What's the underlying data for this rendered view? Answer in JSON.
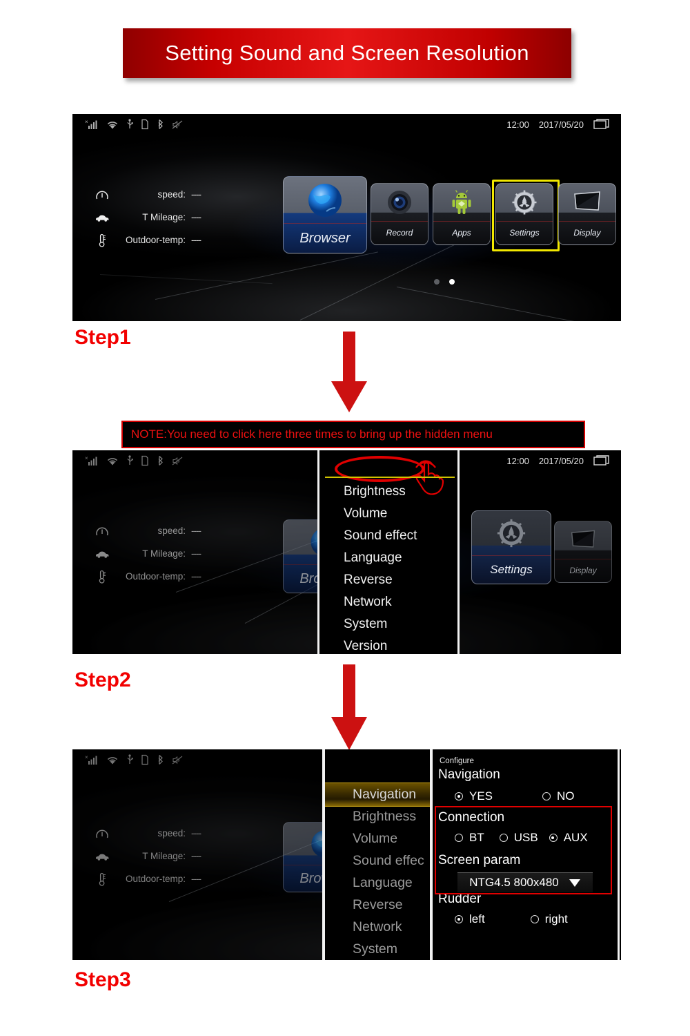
{
  "title": {
    "text": "Setting Sound and Screen Resolution"
  },
  "note": {
    "text": "NOTE:You need to click here three times to bring up the hidden menu"
  },
  "steps": {
    "step1": "Step1",
    "step2": "Step2",
    "step3": "Step3"
  },
  "statusbar": {
    "time": "12:00",
    "date": "2017/05/20",
    "icons": [
      "signal-x-icon",
      "wifi-icon",
      "usb-icon",
      "sdcard-icon",
      "bluetooth-icon",
      "mute-icon"
    ],
    "window_icon": "window-stack-icon"
  },
  "vehicle_info": {
    "rows": [
      {
        "icon": "speedometer-icon",
        "label": "speed:",
        "value": "----"
      },
      {
        "icon": "car-icon",
        "label": "T Mileage:",
        "value": "----"
      },
      {
        "icon": "thermometer-icon",
        "label": "Outdoor-temp:",
        "value": "----"
      }
    ]
  },
  "home_tiles": [
    {
      "label": "Browser",
      "icon": "globe-icon"
    },
    {
      "label": "Record",
      "icon": "camera-lens-icon"
    },
    {
      "label": "Apps",
      "icon": "android-robot-icon"
    },
    {
      "label": "Settings",
      "icon": "gear-icon"
    },
    {
      "label": "Display",
      "icon": "monitor-icon"
    }
  ],
  "highlight_color": "#f2e800",
  "accent_red": "#e10000",
  "hidden_menu": {
    "tap_hint_icon": "hand-tap-icon",
    "items": [
      "Brightness",
      "Volume",
      "Sound effect",
      "Language",
      "Reverse",
      "Network",
      "System",
      "Version"
    ]
  },
  "step2_tiles": [
    {
      "label": "Settings",
      "icon": "gear-icon"
    },
    {
      "label": "Display",
      "icon": "monitor-icon"
    }
  ],
  "step3_menu": {
    "items": [
      "Navigation",
      "Brightness",
      "Volume",
      "Sound effec",
      "Language",
      "Reverse",
      "Network",
      "System"
    ],
    "active_index": 0
  },
  "configure": {
    "caption": "Configure",
    "navigation": {
      "title": "Navigation",
      "options": [
        {
          "label": "YES",
          "selected": true
        },
        {
          "label": "NO",
          "selected": false
        }
      ]
    },
    "connection": {
      "title": "Connection",
      "options": [
        {
          "label": "BT",
          "selected": false
        },
        {
          "label": "USB",
          "selected": false
        },
        {
          "label": "AUX",
          "selected": true
        }
      ]
    },
    "screen_param": {
      "title": "Screen param",
      "value": "NTG4.5  800x480",
      "caret_icon": "chevron-down-icon"
    },
    "rudder": {
      "title": "Rudder",
      "options": [
        {
          "label": "left",
          "selected": true
        },
        {
          "label": "right",
          "selected": false
        }
      ]
    }
  },
  "arrows": {
    "icon": "arrow-down-icon",
    "color": "#cc1111"
  }
}
